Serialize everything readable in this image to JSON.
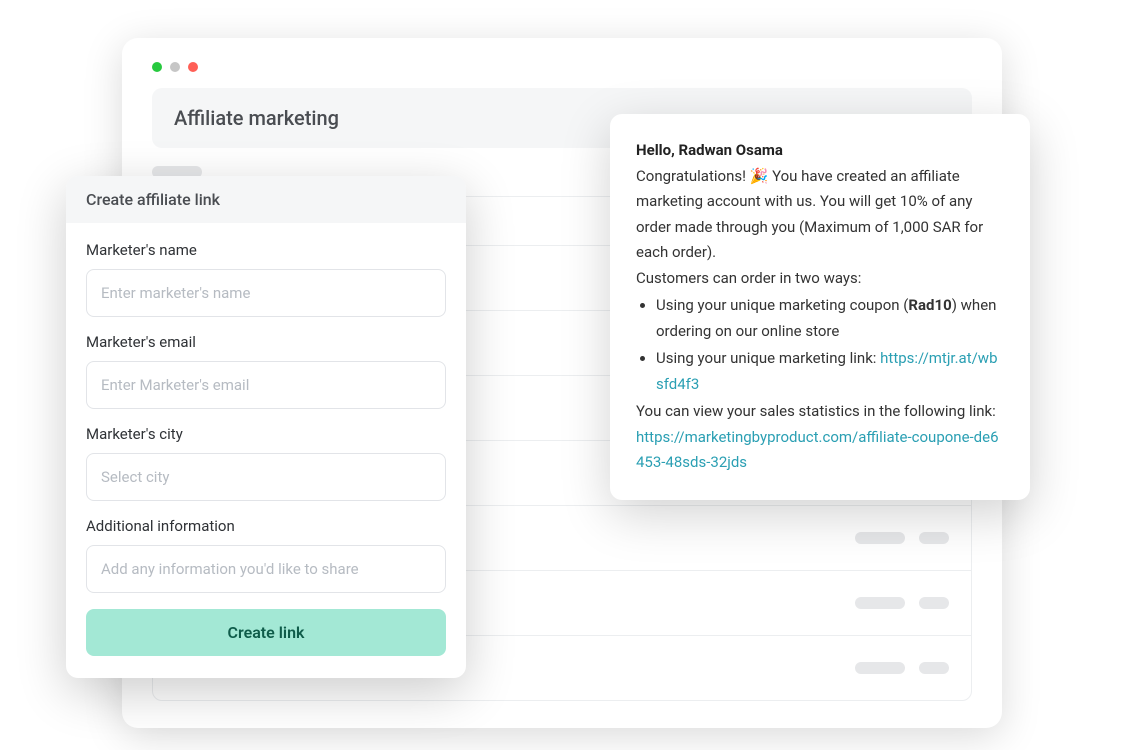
{
  "window": {
    "title": "Affiliate marketing",
    "traffic_colors": [
      "#27c93f",
      "#c6c6c6",
      "#ff5f56"
    ]
  },
  "modal": {
    "title": "Create affiliate link",
    "name_label": "Marketer's name",
    "name_placeholder": "Enter marketer's name",
    "email_label": "Marketer's email",
    "email_placeholder": "Enter Marketer's email",
    "city_label": "Marketer's city",
    "city_placeholder": "Select city",
    "info_label": "Additional information",
    "info_placeholder": "Add any information you'd like to share",
    "submit_label": "Create link"
  },
  "notif": {
    "greeting": "Hello, Radwan Osama",
    "congrats_prefix": "Congratulations! ",
    "emoji": "🎉",
    "body1": " You have created an affiliate marketing account with us. You will get 10% of any order made through you (Maximum of 1,000 SAR for each order).",
    "body2": "Customers can order in two ways:",
    "bullet1_prefix": "Using your unique marketing coupon (",
    "coupon_code": "Rad10",
    "bullet1_suffix": ") when ordering on our online store",
    "bullet2_prefix": "Using your unique marketing link: ",
    "marketing_link": "https://mtjr.at/wbsfd4f3",
    "footer_prefix": "You can view your sales statistics in the following link: ",
    "stats_link": "https://marketingbyproduct.com/affiliate-coupone-de6453-48sds-32jds"
  }
}
